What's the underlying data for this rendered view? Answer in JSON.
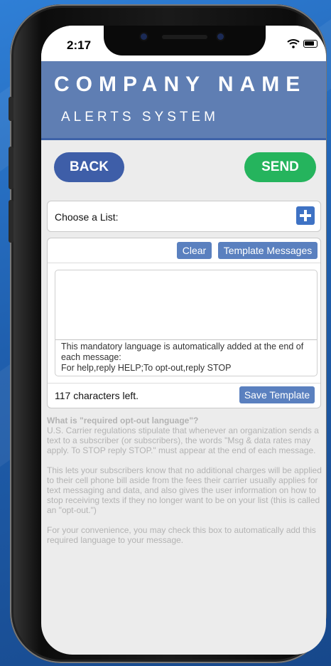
{
  "status_bar": {
    "time": "2:17"
  },
  "header": {
    "company": "COMPANY NAME",
    "subtitle": "ALERTS SYSTEM"
  },
  "nav": {
    "back_label": "BACK",
    "send_label": "SEND"
  },
  "list_picker": {
    "label": "Choose a List:"
  },
  "composer": {
    "clear_label": "Clear",
    "template_messages_label": "Template Messages",
    "mandatory_line1": "This mandatory language is automatically added at the end of each message:",
    "mandatory_line2": "For help,reply HELP;To opt-out,reply STOP",
    "chars_left": "117 characters left.",
    "save_template_label": "Save Template"
  },
  "info": {
    "question": "What is \"required opt-out language\"?",
    "paragraph1": "U.S. Carrier regulations stipulate that whenever an organization sends a text to a subscriber (or subscribers), the words \"Msg & data rates may apply. To STOP reply STOP.\" must appear at the end of each message.",
    "paragraph2": "This lets your subscribers know that no additional charges will be applied to their cell phone bill aside from the fees their carrier usually applies for text messaging and data, and also gives the user information on how to stop receiving texts if they no longer want to be on your list (this is called an \"opt-out.\")",
    "paragraph3": "For your convenience, you may check this box to automatically add this required language to your message."
  },
  "colors": {
    "header_bg": "#5f7eb3",
    "back_button": "#3e5ea8",
    "send_button": "#25b45d",
    "action_button": "#5a80bf"
  },
  "icons": [
    "wifi-icon",
    "battery-icon",
    "plus-icon"
  ]
}
